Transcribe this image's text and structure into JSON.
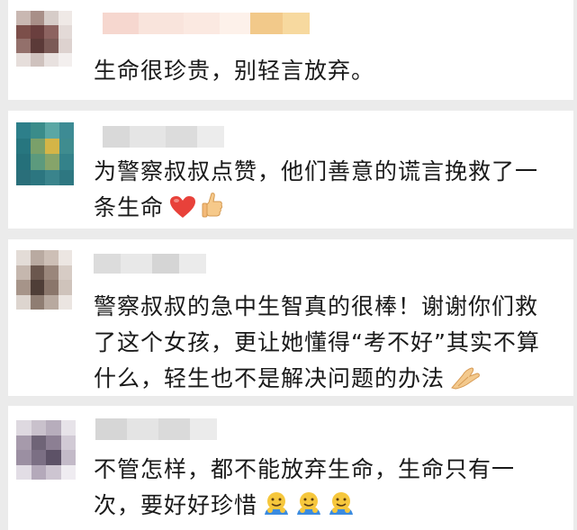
{
  "comments": [
    {
      "text": "生命很珍贵，别轻言放弃。",
      "emojis": []
    },
    {
      "text": "为警察叔叔点赞，他们善意的谎言挽救了一条生命",
      "emojis": [
        "red-heart-icon",
        "thumbs-up-icon"
      ]
    },
    {
      "text": "警察叔叔的急中生智真的很棒！谢谢你们救了这个女孩，更让她懂得“考不好”其实不算什么，轻生也不是解决问题的办法",
      "emojis": [
        "praying-hands-icon"
      ]
    },
    {
      "text": "不管怎样，都不能放弃生命，生命只有一次，要好好珍惜",
      "emojis": [
        "hugging-face-icon",
        "hugging-face-icon",
        "hugging-face-icon"
      ]
    }
  ],
  "colors": {
    "background": "#ebebeb",
    "card": "#ffffff",
    "text": "#1a1a1a",
    "heart": "#e8413a",
    "emoji_yellow": "#f6c73c",
    "emoji_blue": "#3b8be0"
  }
}
